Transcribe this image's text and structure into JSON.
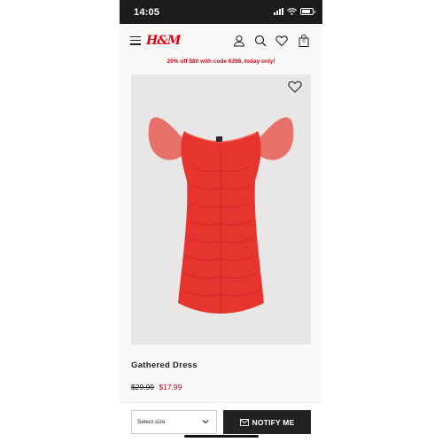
{
  "status_bar": {
    "time": "14:05"
  },
  "header": {
    "logo": "H&M",
    "cart_count": "0"
  },
  "promo": {
    "text": "20% off $80 with code 6398, today only!"
  },
  "product": {
    "name": "Gathered Dress",
    "old_price": "$29.99",
    "new_price": "$17.99",
    "image_description": "red mesh mini dress with puff sleeves"
  },
  "bottom_bar": {
    "size_placeholder": "Select size",
    "notify_label": "NOTIFY ME"
  },
  "colors": {
    "brand_red": "#e50010",
    "price_red": "#c4051c",
    "dress_red": "#e8342f",
    "button_dark": "#222222"
  }
}
